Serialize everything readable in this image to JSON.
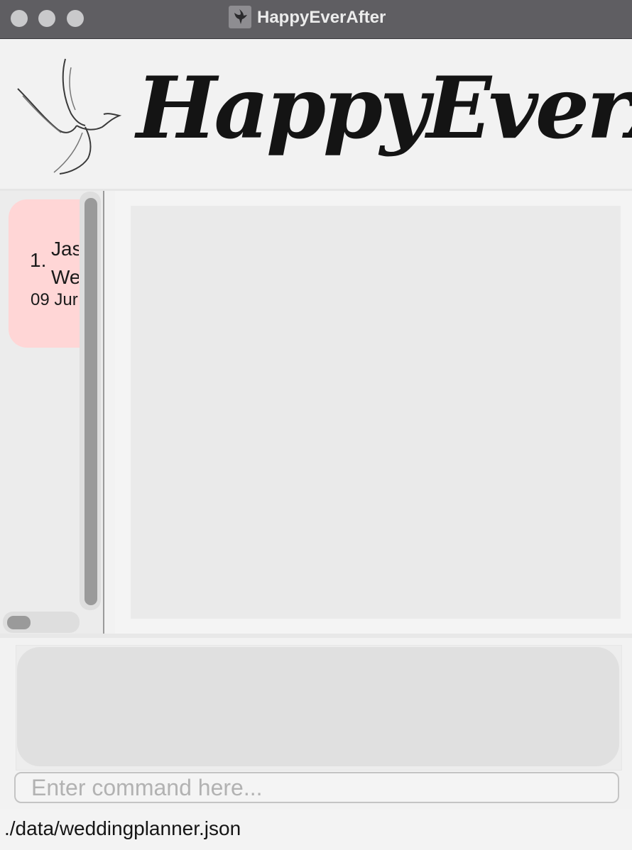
{
  "window": {
    "title": "HappyEverAfter",
    "icon": "dove-icon",
    "controls": [
      "close-window-button",
      "minimize-window-button",
      "zoom-window-button"
    ]
  },
  "banner": {
    "logo_text": "HappyEverAfter",
    "logo_icon": "dove-icon"
  },
  "wedding_list": {
    "items": [
      {
        "index": "1.",
        "title_visible": "Jas\nWe",
        "date_visible": "09 Jur"
      }
    ]
  },
  "result_display": {
    "text": ""
  },
  "command_box": {
    "placeholder": "Enter command here...",
    "value": ""
  },
  "status_bar": {
    "file_path": "./data/weddingplanner.json"
  },
  "colors": {
    "titlebar": "#5f5e62",
    "list_card": "#ffd6d6",
    "scroll_thumb": "#9a9a9a",
    "result_box": "#e0e0e0"
  }
}
